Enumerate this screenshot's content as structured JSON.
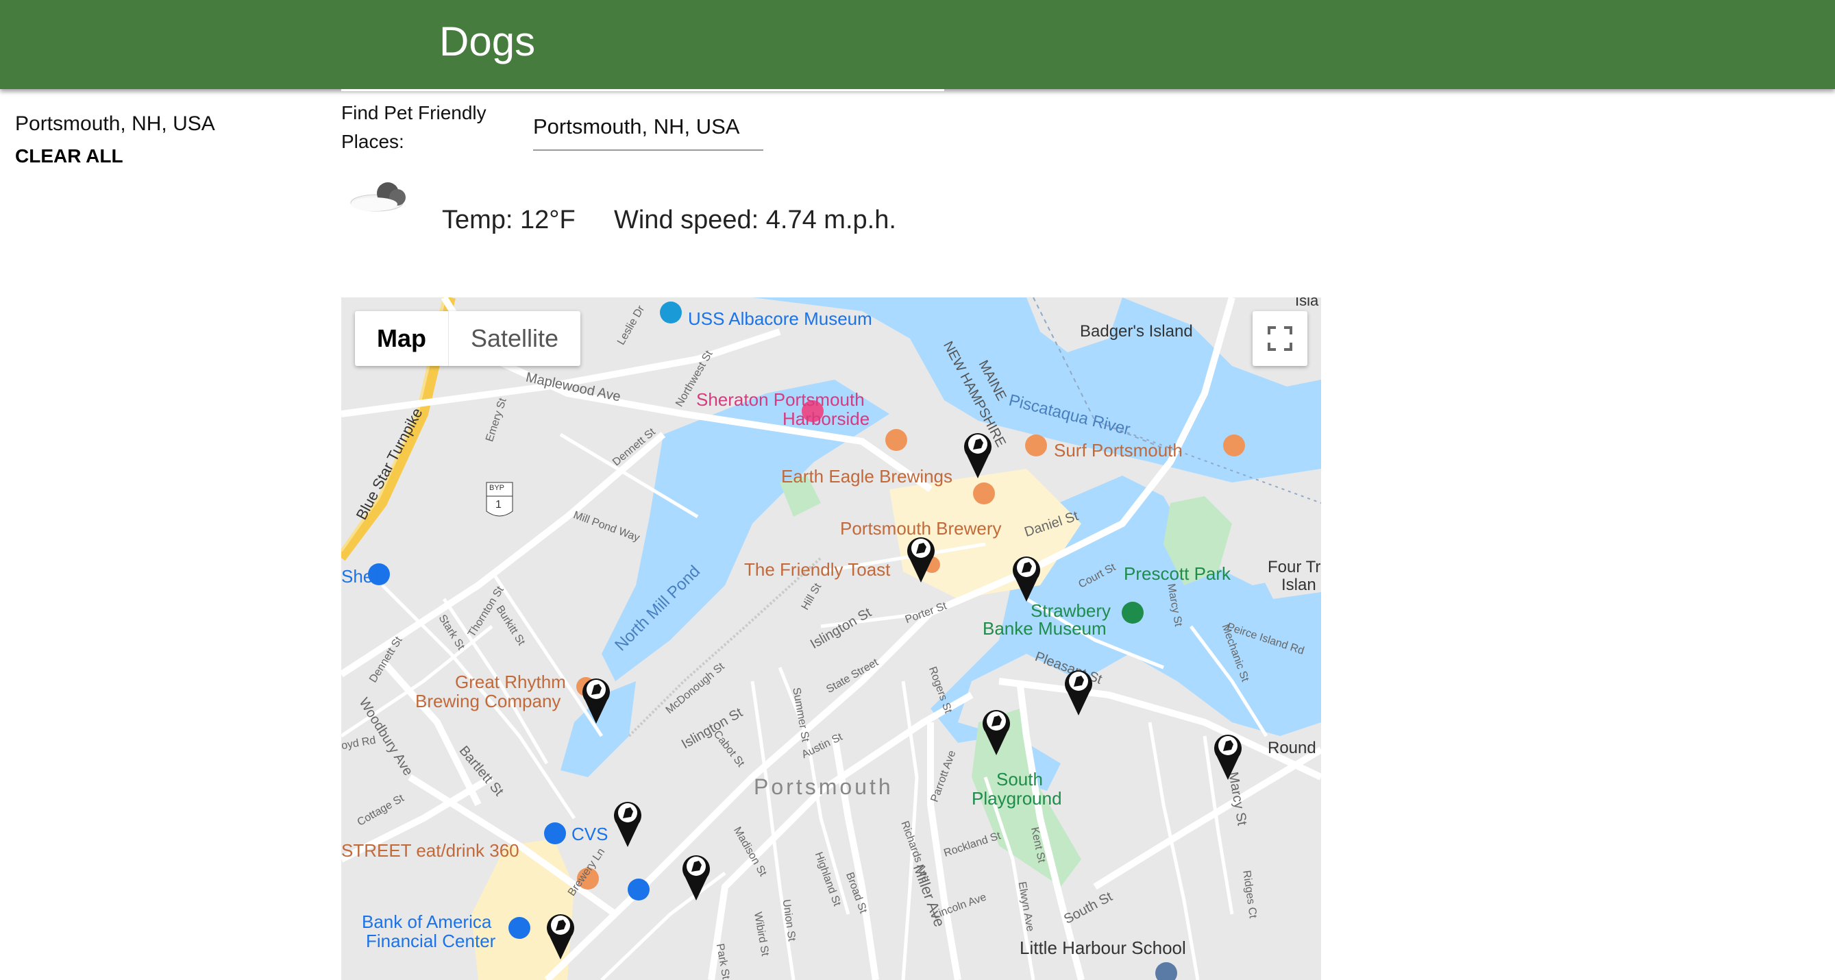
{
  "header": {
    "title": "Dogs"
  },
  "sidebar": {
    "location": "Portsmouth, NH, USA",
    "clear_label": "CLEAR ALL"
  },
  "search": {
    "label": "Find Pet Friendly Places:",
    "value": "Portsmouth, NH, USA"
  },
  "weather": {
    "icon": "cloud-icon",
    "temp": "Temp: 12°F",
    "wind": "Wind speed: 4.74 m.p.h."
  },
  "map": {
    "type_options": [
      "Map",
      "Satellite"
    ],
    "selected_type": "Map",
    "places": {
      "uss_albacore": "USS Albacore Museum",
      "badgers_island": "Badger's Island",
      "sheraton_1": "Sheraton Portsmouth",
      "sheraton_2": "Harborside",
      "surf": "Surf Portsmouth",
      "earth_eagle": "Earth Eagle Brewings",
      "portsmouth_brewery": "Portsmouth Brewery",
      "friendly_toast": "The Friendly Toast",
      "prescott_park": "Prescott Park",
      "strawbery_1": "Strawbery",
      "strawbery_2": "Banke Museum",
      "great_rhythm_1": "Great Rhythm",
      "great_rhythm_2": "Brewing Company",
      "shell": "Shell",
      "cvs": "CVS",
      "street_eat": "STREET eat/drink 360",
      "boa_1": "Bank of America",
      "boa_2": "Financial Center",
      "south_playground_1": "South",
      "south_playground_2": "Playground",
      "little_harbour": "Little Harbour School",
      "portsmouth_town": "Portsmouth",
      "four_tree_1": "Four Tr",
      "four_tree_2": "Islan",
      "round": "Round",
      "isla": "Isla",
      "state_maine": "MAINE",
      "state_nh": "NEW HAMPSHIRE",
      "piscataqua": "Piscataqua River",
      "north_mill_pond": "North Mill Pond",
      "blue_star": "Blue Star Turnpike",
      "byp": "BYP",
      "route": "1"
    },
    "streets": {
      "maplewood": "Maplewood Ave",
      "daniel": "Daniel St",
      "islington1": "Islington St",
      "islington2": "Islington St",
      "state": "State Street",
      "court": "Court St",
      "pleasant": "Pleasant St",
      "marcy": "Marcy St",
      "marcy2": "Marcy St",
      "south": "South St",
      "miller": "Miller Ave",
      "bartlett": "Bartlett St",
      "woodbury": "Woodbury Ave",
      "dennett": "Dennett St",
      "dennett2": "Dennett St",
      "thornton": "Thornton St",
      "burkitt": "Burkitt St",
      "stark": "Stark St",
      "cottage": "Cottage St",
      "mcdonough": "McDonough St",
      "cabot": "Cabot St",
      "summer": "Summer St",
      "austin": "Austin St",
      "rogers": "Rogers St",
      "parrott": "Parrott Ave",
      "richards": "Richards Ave",
      "rockland": "Rockland St",
      "lincoln": "Lincoln Ave",
      "elwyn": "Elwyn Ave",
      "kent": "Kent St",
      "madison": "Madison St",
      "union": "Union St",
      "highland": "Highland St",
      "broad": "Broad St",
      "wibird": "Wibird St",
      "park": "Park St",
      "brewery": "Brewery Ln",
      "hill": "Hill St",
      "porter": "Porter St",
      "mechanic": "Mechanic St",
      "peirce": "Peirce Island Rd",
      "ridges": "Ridges Ct",
      "mill_pond": "Mill Pond Way",
      "northwest": "Northwest St",
      "emery": "Emery St",
      "leslie": "Leslie Dr",
      "boyd": "oyd Rd"
    }
  }
}
